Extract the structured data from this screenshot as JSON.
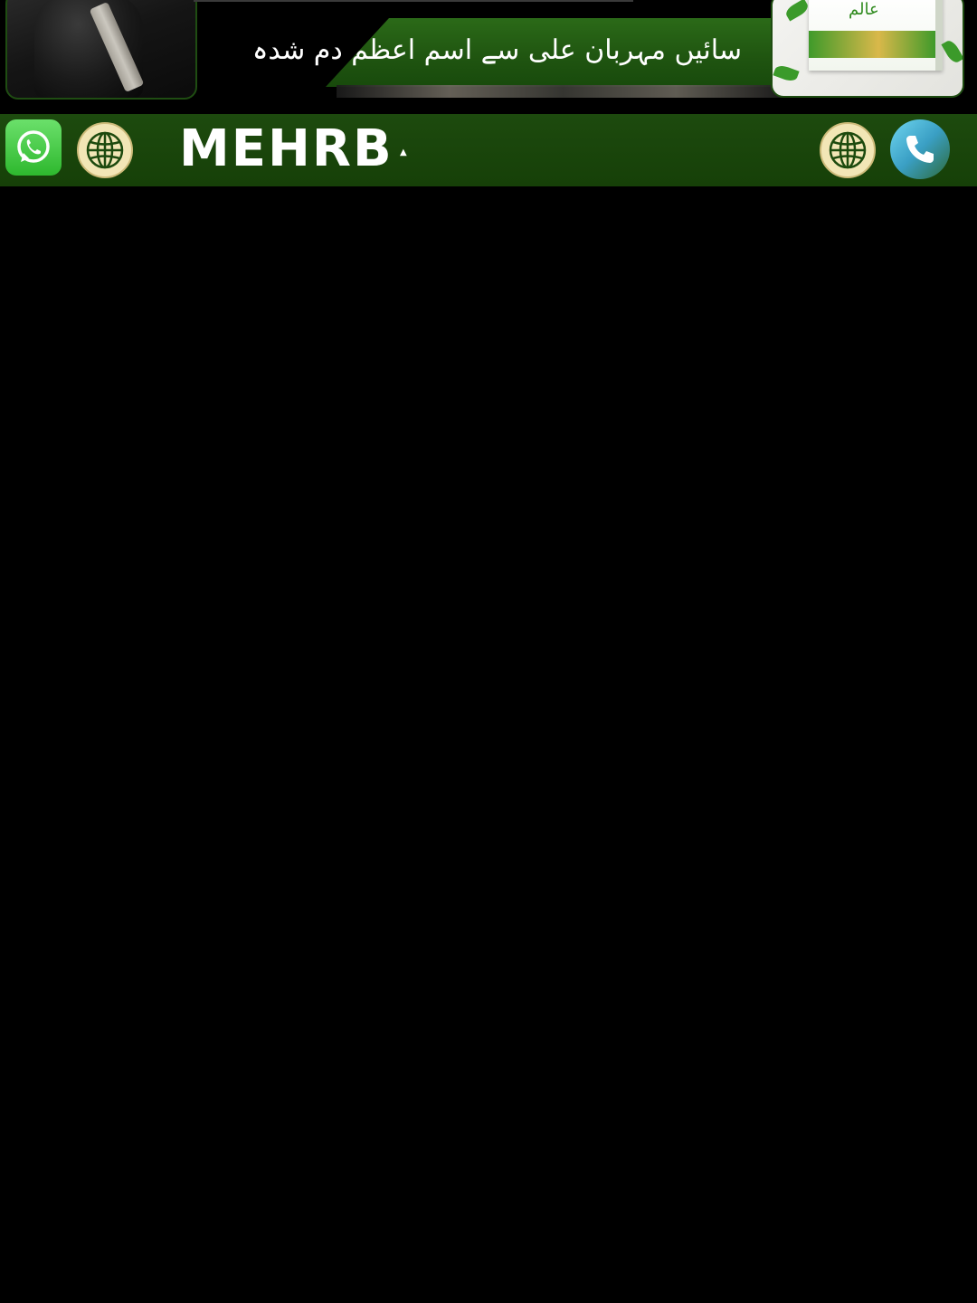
{
  "banner": {
    "tagline": "سائیں مہربان علی سے اسم اعظم دم شدہ",
    "product_script": "عالم"
  },
  "toolbar": {
    "brand": "MEHRB",
    "caret": "▲",
    "background": "#1d4a0e"
  },
  "icons": {
    "whatsapp": "whatsapp-icon",
    "globe_left": "globe-icon",
    "globe_right": "globe-icon",
    "phone": "phone-icon"
  },
  "colors": {
    "accent_green": "#1f5410",
    "whatsapp_green": "#2eb82e",
    "globe_fill": "#f2e6b6",
    "phone_blue": "#3a9fc4"
  }
}
